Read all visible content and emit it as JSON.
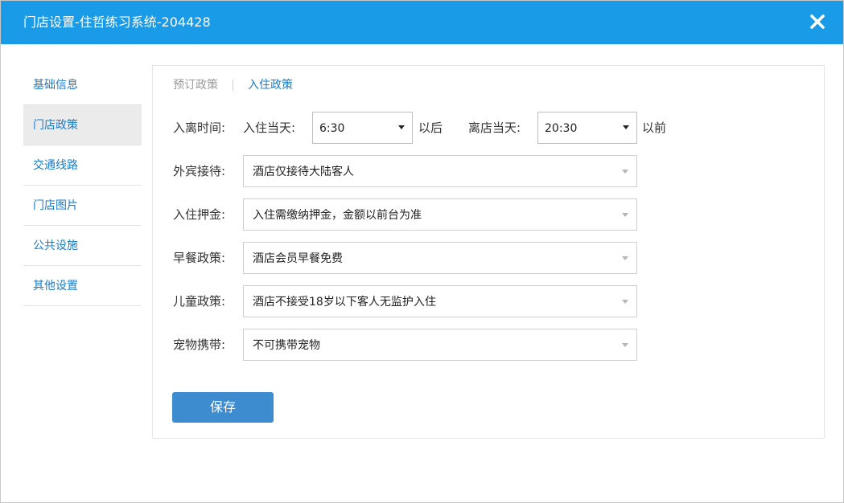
{
  "window": {
    "title": "门店设置-住哲练习系统-204428",
    "close_icon": "close-icon"
  },
  "sidebar": {
    "items": [
      {
        "label": "基础信息",
        "active": false
      },
      {
        "label": "门店政策",
        "active": true
      },
      {
        "label": "交通线路",
        "active": false
      },
      {
        "label": "门店图片",
        "active": false
      },
      {
        "label": "公共设施",
        "active": false
      },
      {
        "label": "其他设置",
        "active": false
      }
    ]
  },
  "tabs": [
    {
      "label": "预订政策",
      "active": false
    },
    {
      "label": "入住政策",
      "active": true
    }
  ],
  "checkin_time": {
    "label": "入离时间:",
    "checkin_label": "入住当天:",
    "checkin_value": "6:30",
    "checkin_suffix": "以后",
    "checkout_label": "离店当天:",
    "checkout_value": "20:30",
    "checkout_suffix": "以前"
  },
  "policies": [
    {
      "label": "外宾接待:",
      "value": "酒店仅接待大陆客人"
    },
    {
      "label": "入住押金:",
      "value": "入住需缴纳押金，金额以前台为准"
    },
    {
      "label": "早餐政策:",
      "value": "酒店会员早餐免费"
    },
    {
      "label": "儿童政策:",
      "value": "酒店不接受18岁以下客人无监护入住"
    },
    {
      "label": "宠物携带:",
      "value": "不可携带宠物"
    }
  ],
  "save_label": "保存",
  "colors": {
    "titlebar": "#1a9be8",
    "link": "#1a7cc8",
    "save_button": "#3d8ccf"
  }
}
